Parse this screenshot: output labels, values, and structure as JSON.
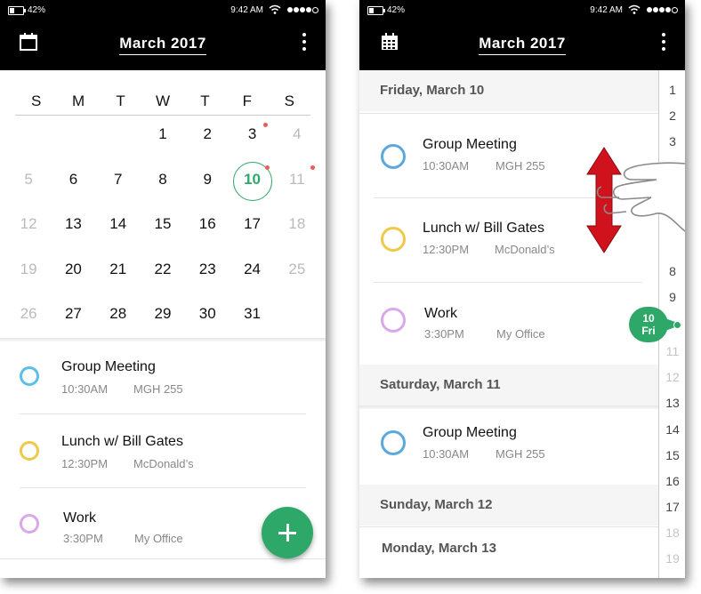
{
  "status": {
    "battery": "42%",
    "time": "9:42 AM"
  },
  "header": {
    "title": "March  2017"
  },
  "calendar": {
    "weekdays": [
      "S",
      "M",
      "T",
      "W",
      "T",
      "F",
      "S"
    ],
    "weeks": [
      [
        "",
        "",
        "",
        "1",
        "2",
        "3",
        "4"
      ],
      [
        "5",
        "6",
        "7",
        "8",
        "9",
        "10",
        "11"
      ],
      [
        "12",
        "13",
        "14",
        "15",
        "16",
        "17",
        "18"
      ],
      [
        "19",
        "20",
        "21",
        "22",
        "23",
        "24",
        "25"
      ],
      [
        "26",
        "27",
        "28",
        "29",
        "30",
        "31",
        ""
      ]
    ],
    "selected_day": "10"
  },
  "events_left": [
    {
      "title": "Group Meeting",
      "time": "10:30AM",
      "location": "MGH 255",
      "color": "#5bc0e8"
    },
    {
      "title": "Lunch w/ Bill Gates",
      "time": "12:30PM",
      "location": "McDonald’s",
      "color": "#f0c84a"
    },
    {
      "title": "Work",
      "time": "3:30PM",
      "location": "My Office",
      "color": "#d9a8e8"
    }
  ],
  "agenda": {
    "days": [
      {
        "label": "Friday, March 10"
      },
      {
        "label": "Saturday, March 11"
      },
      {
        "label": "Sunday, March 12"
      },
      {
        "label": "Monday, March 13"
      }
    ],
    "friday_events": [
      {
        "title": "Group Meeting",
        "time": "10:30AM",
        "location": "MGH 255",
        "color": "#5ba8dc"
      },
      {
        "title": "Lunch w/ Bill Gates",
        "time": "12:30PM",
        "location": "McDonald’s",
        "color": "#f0c84a"
      },
      {
        "title": "Work",
        "time": "3:30PM",
        "location": "My Office",
        "color": "#d9a8e8"
      }
    ],
    "saturday_events": [
      {
        "title": "Group Meeting",
        "time": "10:30AM",
        "location": "MGH 255",
        "color": "#5ba8dc"
      }
    ]
  },
  "scroller": {
    "numbers": [
      "1",
      "2",
      "3",
      "8",
      "9",
      "11",
      "12",
      "13",
      "14",
      "15",
      "16",
      "17",
      "18",
      "19"
    ],
    "dim_numbers": [
      "11",
      "12",
      "18",
      "19"
    ],
    "pin_day": "10",
    "pin_weekday": "Fri"
  },
  "icons": {
    "calendar": "calendar-icon",
    "menu": "kebab-menu-icon",
    "add": "plus-icon",
    "gesture": "swipe-hand-icon"
  },
  "colors": {
    "accent": "#2ea868",
    "header_bg": "#000000",
    "notification_dot": "#f05a5a",
    "gesture_arrow": "#d0121c"
  }
}
